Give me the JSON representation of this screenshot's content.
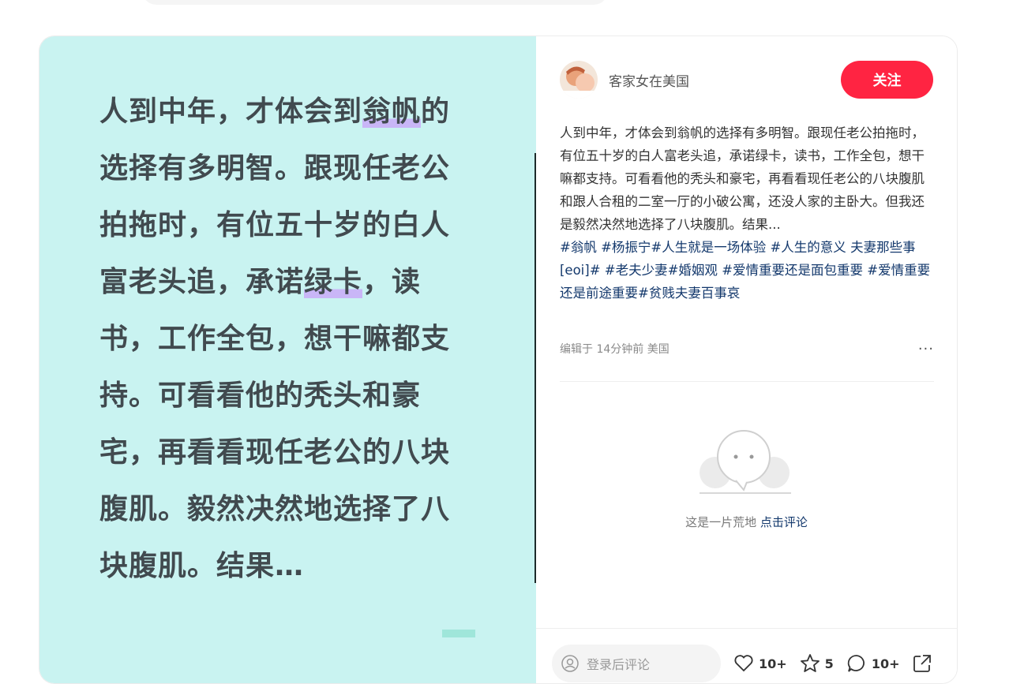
{
  "media": {
    "text_segments": [
      {
        "text": "人到中年，才体会到",
        "hl": false
      },
      {
        "text": "翁帆",
        "hl": true
      },
      {
        "text": "的选择有多明智。跟现任老公拍拖时，有位五十岁的白人富老头追，承诺",
        "hl": false
      },
      {
        "text": "绿卡",
        "hl": true
      },
      {
        "text": "，读书，工作全包，想干嘛都支持。可看看他的秃头和豪宅，再看看现任老公的八块腹肌。毅然决然地选择了八块腹肌。结果…",
        "hl": false
      }
    ],
    "background": "#c9f3f1",
    "highlight_color": "#c9b6f7"
  },
  "author": {
    "name": "客家女在美国",
    "follow_label": "关注",
    "follow_color": "#ff2442"
  },
  "post": {
    "body": "人到中年，才体会到翁帆的选择有多明智。跟现任老公拍拖时，有位五十岁的白人富老头追，承诺绿卡，读书，工作全包，想干嘛都支持。可看看他的秃头和豪宅，再看看现任老公的八块腹肌和跟人合租的二室一厅的小破公寓，还没人家的主卧大。但我还是毅然决然地选择了八块腹肌。结果...",
    "tags_html_parts": [
      {
        "text": "#翁帆 ",
        "tag": true
      },
      {
        "text": "#杨振宁",
        "tag": true
      },
      {
        "text": "#人生就是一场体验 ",
        "tag": true
      },
      {
        "text": "#人生的意义 ",
        "tag": true
      },
      {
        "text": "夫妻那些事[eoi]# ",
        "tag": false
      },
      {
        "text": "#老夫少妻",
        "tag": true
      },
      {
        "text": "#婚姻观 ",
        "tag": true
      },
      {
        "text": "#爱情重要还是面包重要 ",
        "tag": true
      },
      {
        "text": "#爱情重要还是前途重要",
        "tag": true
      },
      {
        "text": "#贫贱夫妻百事哀",
        "tag": true
      }
    ],
    "meta": "编辑于 14分钟前 美国",
    "more_label": "···",
    "link_color": "#13386c"
  },
  "comments": {
    "empty_text": "这是一片荒地 ",
    "empty_link": "点击评论"
  },
  "bottom": {
    "comment_placeholder": "登录后评论",
    "likes": "10+",
    "collects": "5",
    "comments_count": "10+"
  }
}
